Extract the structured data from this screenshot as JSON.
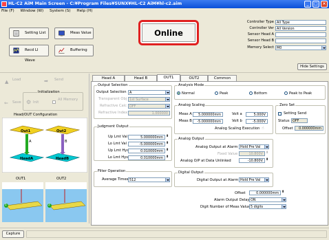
{
  "window": {
    "title": "HL-C2 AiM Main Screen - C:¥Program Files¥SUNX¥HL-C2 AiM¥hl-c2.aim"
  },
  "menu": [
    "File (F)",
    "Window (W)",
    "System (S)",
    "Help (H)"
  ],
  "toolbar": {
    "setting_list": "Setting List",
    "meas_value": "Meas Value",
    "record_lj_wave": "Recd LI Wave",
    "buffering": "Buffering"
  },
  "status": {
    "online": "Online"
  },
  "controller": {
    "type_label": "Controller Type",
    "type_value": "All Type",
    "ver_label": "Controller Ver",
    "ver_value": "All Version",
    "sensor_a_label": "Sensor Head A",
    "sensor_a_value": "",
    "sensor_b_label": "Sensor Head B",
    "sensor_b_value": "",
    "memory_label": "Memory Select",
    "memory_value": "M0",
    "hide_settings": "Hide Settings"
  },
  "left": {
    "load": "Load",
    "send": "Send",
    "save": "Save",
    "init_group": "Initialization",
    "init": "Init",
    "all_memory": "All Memory",
    "config_title": "Head/OUT Configuration",
    "out1": "Out1",
    "out2": "Out2",
    "a": "A",
    "b": "B",
    "head_a": "HeadA",
    "head_b": "HeadB",
    "out1_label": "OUT1",
    "out2_label": "OUT2",
    "num1": "1",
    "num2": "2"
  },
  "tabs": [
    "Head A",
    "Head B",
    "OUT1",
    "OUT2",
    "Common"
  ],
  "active_tab": "OUT1",
  "output_selection": {
    "title": "Output Selection",
    "output_selection_label": "Output Selection",
    "output_selection_value": "A",
    "transparent_obj_label": "Transparent Obj",
    "transparent_obj_value": "1st Surface",
    "refractive_calc_label": "Refractive Calc",
    "refractive_calc_value": "OFF",
    "refractive_index_label": "Refractive Index",
    "refractive_index_value": "1.000000"
  },
  "judgment": {
    "title": "Judgment Output",
    "up_lmt_label": "Up Lmt Val",
    "up_lmt_value": "5.000000mm",
    "lo_lmt_label": "Lo Lmt Val",
    "lo_lmt_value": "-5.000000mm",
    "up_hys_label": "Up Lmt Hys",
    "up_hys_value": "0.010000mm",
    "lo_hys_label": "Lo Lmt Hys",
    "lo_hys_value": "0.010000mm"
  },
  "filter": {
    "title": "Filter Operation",
    "avg_label": "Average Times",
    "avg_value": "512"
  },
  "analysis": {
    "title": "Analysis Mode",
    "options": [
      "Normal",
      "Peak",
      "Bottom",
      "Peak to Peak"
    ],
    "selected": "Normal"
  },
  "scaling": {
    "title": "Analog Scaling",
    "meas_a_label": "Meas A",
    "meas_a_value": "5.000000mm",
    "volt_a_label": "Volt a",
    "volt_a_value": "5.000V",
    "meas_b_label": "Meas B",
    "meas_b_value": "-5.000000mm",
    "volt_b_label": "Volt b",
    "volt_b_value": "-5.000V",
    "exec_label": "Analog Scaling Execution"
  },
  "zero_set": {
    "title": "Zero Set",
    "setting_send": "Setting Send",
    "status_label": "Status",
    "status_value": "OFF",
    "offset_label": "Offset",
    "offset_value": "0.000000mm"
  },
  "analog_output": {
    "title": "Analog Output",
    "alarm_label": "Analog Output at Alarm",
    "alarm_value": "Hold Pre Val",
    "fixed_label": "Fixed Value",
    "fixed_value": "10.800V",
    "unlinked_label": "Analog O/P at Data Unlinked",
    "unlinked_value": "-10.800V"
  },
  "digital_output": {
    "title": "Digital Output",
    "alarm_label": "Digital Output at Alarm",
    "alarm_value": "Hold Pre Val"
  },
  "misc": {
    "offset_label": "Offset",
    "offset_value": "0.000000mm",
    "alarm_delay_label": "Alarm Output Delay",
    "alarm_delay_value": "ON",
    "digit_label": "Digit Number of Meas Value",
    "digit_value": "5 digits"
  },
  "statusbar": {
    "capture": "Capture"
  },
  "colors": {
    "titlebar": "#0A50D8",
    "online_border": "#E02020",
    "green": "#22AA22",
    "yellow": "#F0D020",
    "purple": "#8A60C0",
    "cyan": "#00C8D0"
  }
}
